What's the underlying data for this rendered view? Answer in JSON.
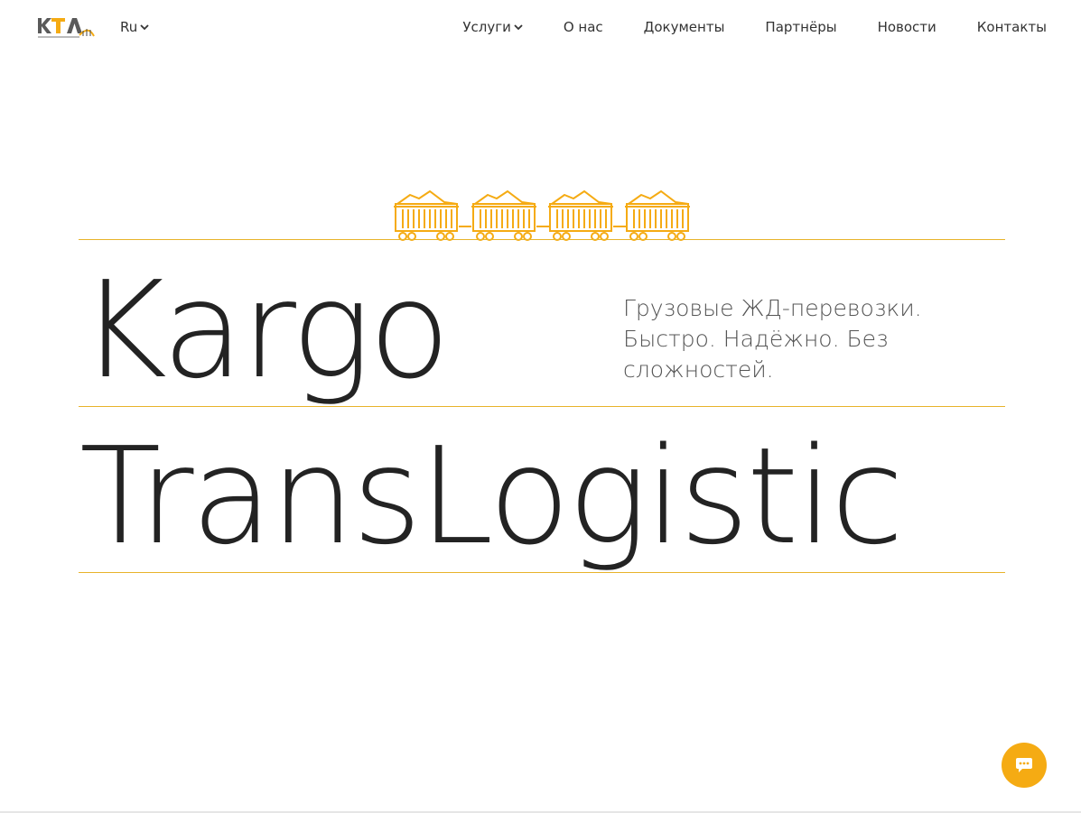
{
  "header": {
    "logo_text": "КТЛ",
    "logo_subtext": "Kargo TransLogistic",
    "language": "Ru",
    "nav": [
      {
        "label": "Услуги",
        "has_dropdown": true
      },
      {
        "label": "О нас"
      },
      {
        "label": "Документы"
      },
      {
        "label": "Партнёры"
      },
      {
        "label": "Новости"
      },
      {
        "label": "Контакты"
      }
    ]
  },
  "hero": {
    "title_line1": "Kargo",
    "title_line2": "TransLogistic",
    "tagline": "Грузовые ЖД-перевозки. Быстро. Надёжно. Без сложностей."
  },
  "colors": {
    "accent": "#f5ab13",
    "rule": "#e8b32a",
    "text": "#232323"
  },
  "icons": {
    "train": "freight-train-icon",
    "chat": "chat-bubble-icon",
    "chevron": "chevron-down-icon"
  }
}
